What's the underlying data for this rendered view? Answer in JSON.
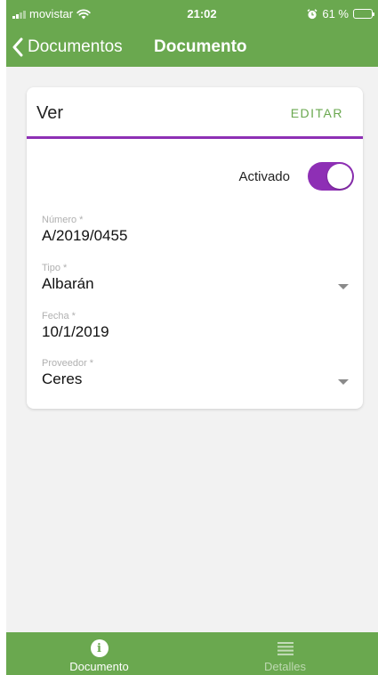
{
  "status_bar": {
    "carrier": "movistar",
    "time": "21:02",
    "battery": "61 %",
    "battery_level": 0.61
  },
  "nav": {
    "back_label": "Documentos",
    "title": "Documento"
  },
  "card": {
    "title": "Ver",
    "edit_label": "EDITAR",
    "toggle": {
      "label": "Activado",
      "on": true
    },
    "fields": [
      {
        "label": "Número *",
        "value": "A/2019/0455",
        "dropdown": false
      },
      {
        "label": "Tipo *",
        "value": "Albarán",
        "dropdown": true
      },
      {
        "label": "Fecha *",
        "value": "10/1/2019",
        "dropdown": false
      },
      {
        "label": "Proveedor *",
        "value": "Ceres",
        "dropdown": true
      }
    ]
  },
  "tabbar": {
    "tabs": [
      {
        "label": "Documento",
        "icon": "info-icon",
        "active": true
      },
      {
        "label": "Detalles",
        "icon": "list-icon",
        "active": false
      }
    ]
  },
  "colors": {
    "brand_green": "#6aa84f",
    "accent_purple": "#8e2fb5"
  }
}
